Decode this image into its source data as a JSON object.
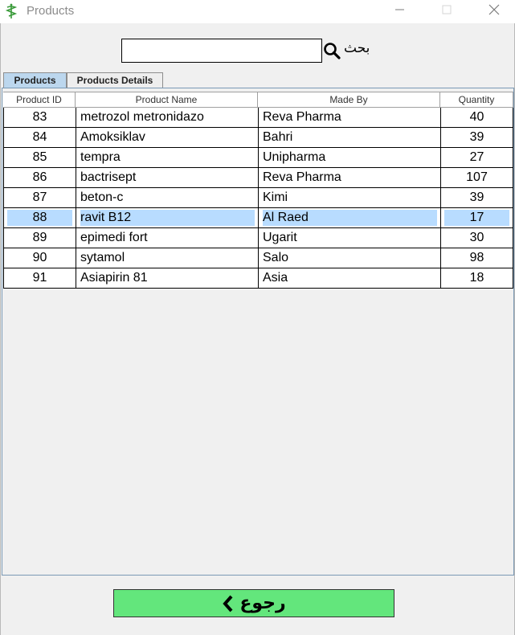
{
  "window": {
    "title": "Products",
    "icon": "medical-caduceus-icon",
    "controls": [
      "minimize-icon",
      "maximize-icon",
      "close-icon"
    ]
  },
  "search": {
    "label": "بحث",
    "value": "",
    "placeholder": "",
    "icon": "search-icon"
  },
  "tabs": [
    {
      "label": "Products",
      "active": true
    },
    {
      "label": "Products Details",
      "active": false
    }
  ],
  "table": {
    "columns": [
      "Product ID",
      "Product Name",
      "Made By",
      "Quantity"
    ],
    "rows": [
      {
        "id": "83",
        "name": "metrozol metronidazo",
        "made_by": "Reva Pharma",
        "quantity": "40"
      },
      {
        "id": "84",
        "name": "Amoksiklav",
        "made_by": "Bahri",
        "quantity": "39"
      },
      {
        "id": "85",
        "name": "tempra",
        "made_by": "Unipharma",
        "quantity": "27"
      },
      {
        "id": "86",
        "name": "bactrisept",
        "made_by": "Reva Pharma",
        "quantity": "107"
      },
      {
        "id": "87",
        "name": "beton-c",
        "made_by": "Kimi",
        "quantity": "39"
      },
      {
        "id": "88",
        "name": "ravit B12",
        "made_by": "Al Raed",
        "quantity": "17"
      },
      {
        "id": "89",
        "name": "epimedi fort",
        "made_by": "Ugarit",
        "quantity": "30"
      },
      {
        "id": "90",
        "name": "sytamol",
        "made_by": "Salo",
        "quantity": "98"
      },
      {
        "id": "91",
        "name": "Asiapirin 81",
        "made_by": "Asia",
        "quantity": "18"
      }
    ],
    "selected_row_index": 5
  },
  "back_button": {
    "label": "رجوع",
    "icon": "chevron-left-icon",
    "color": "#63e67c"
  },
  "colors": {
    "selection": "#b8dcff",
    "active_tab": "#bcd7ee",
    "panel_border": "#7a99b5"
  }
}
